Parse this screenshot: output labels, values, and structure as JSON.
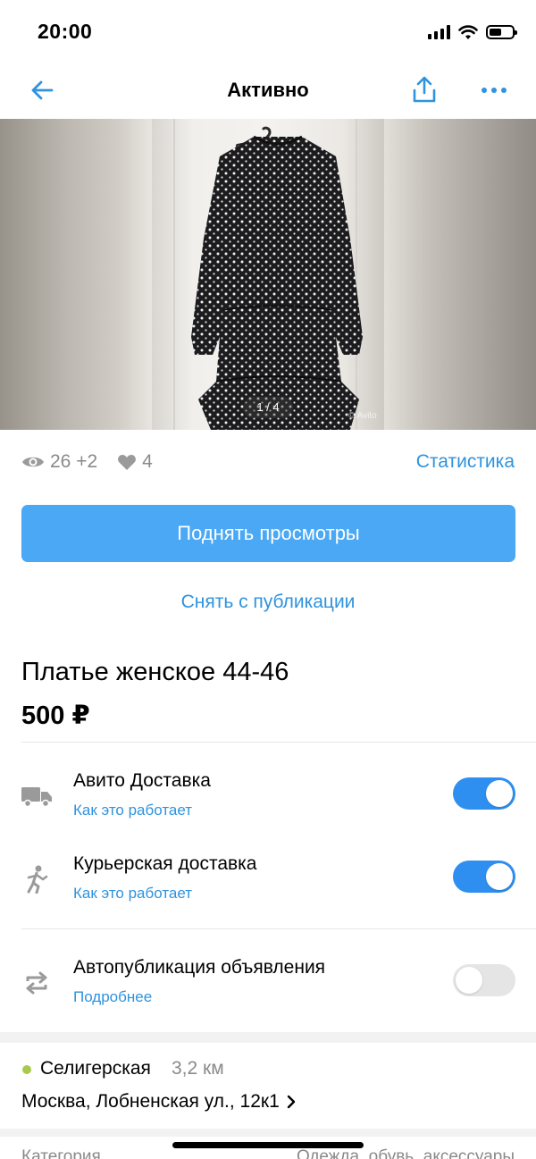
{
  "status_bar": {
    "time": "20:00"
  },
  "nav": {
    "title": "Активно"
  },
  "gallery": {
    "counter": "1 / 4",
    "watermark": "© Avito"
  },
  "stats": {
    "views": "26 +2",
    "favorites": "4",
    "link": "Статистика"
  },
  "actions": {
    "raise_label": "Поднять просмотры",
    "unpublish_label": "Снять с публикации"
  },
  "item": {
    "title": "Платье женское 44-46",
    "price": "500 ₽"
  },
  "options": [
    {
      "title": "Авито Доставка",
      "link": "Как это работает",
      "icon": "truck-icon",
      "enabled": true
    },
    {
      "title": "Курьерская доставка",
      "link": "Как это работает",
      "icon": "courier-icon",
      "enabled": true
    },
    {
      "title": "Автопубликация объявления",
      "link": "Подробнее",
      "icon": "autopublish-icon",
      "enabled": false
    }
  ],
  "location": {
    "metro": "Селигерская",
    "distance": "3,2 км",
    "address": "Москва, Лобненская ул., 12к1",
    "metro_color": "#a9c94e"
  },
  "details": {
    "category_label": "Категория",
    "category_value": "Одежда, обувь, аксессуары"
  },
  "colors": {
    "accent": "#2f93de",
    "button": "#4aa8f5",
    "toggle_on": "#2f8ff0",
    "toggle_off": "#e5e5e5"
  }
}
